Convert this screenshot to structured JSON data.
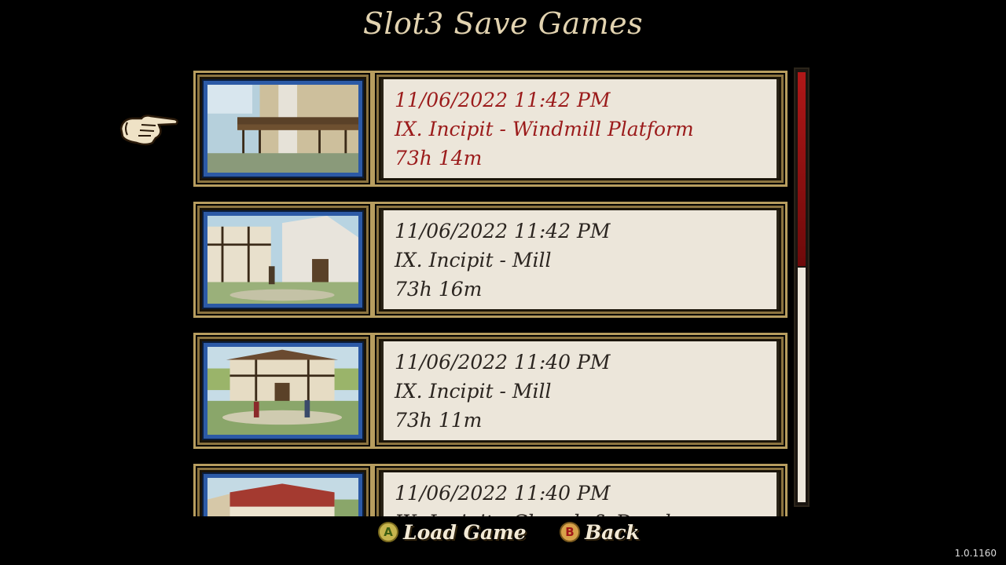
{
  "screen": {
    "title": "Slot3 Save Games",
    "version": "1.0.1160"
  },
  "saves": [
    {
      "datetime": "11/06/2022 11:42 PM",
      "location": "IX. Incipit - Windmill Platform",
      "playtime": "73h 14m",
      "selected": true,
      "thumbnail": "windmill-platform"
    },
    {
      "datetime": "11/06/2022 11:42 PM",
      "location": "IX. Incipit - Mill",
      "playtime": "73h 16m",
      "selected": false,
      "thumbnail": "mill-street"
    },
    {
      "datetime": "11/06/2022 11:40 PM",
      "location": "IX. Incipit - Mill",
      "playtime": "73h 11m",
      "selected": false,
      "thumbnail": "mill-villagers"
    },
    {
      "datetime": "11/06/2022 11:40 PM",
      "location": "IX. Incipit - Church & Druckers",
      "playtime": "",
      "selected": false,
      "thumbnail": "church-houses"
    }
  ],
  "scrollbar": {
    "position_fraction": 0.45
  },
  "actions": {
    "load": {
      "button": "A",
      "label": "Load Game"
    },
    "back": {
      "button": "B",
      "label": "Back"
    }
  },
  "icons": {
    "selection_pointer": "pointing-hand-icon"
  },
  "colors": {
    "selected_text": "#9b1b1b",
    "normal_text": "#2b2520",
    "parchment": "#ece6da",
    "gold_frame": "#b79d5f",
    "thumb_border": "#2c5aa6",
    "title": "#e2d3b0",
    "scroll_thumb": "#b01818"
  }
}
